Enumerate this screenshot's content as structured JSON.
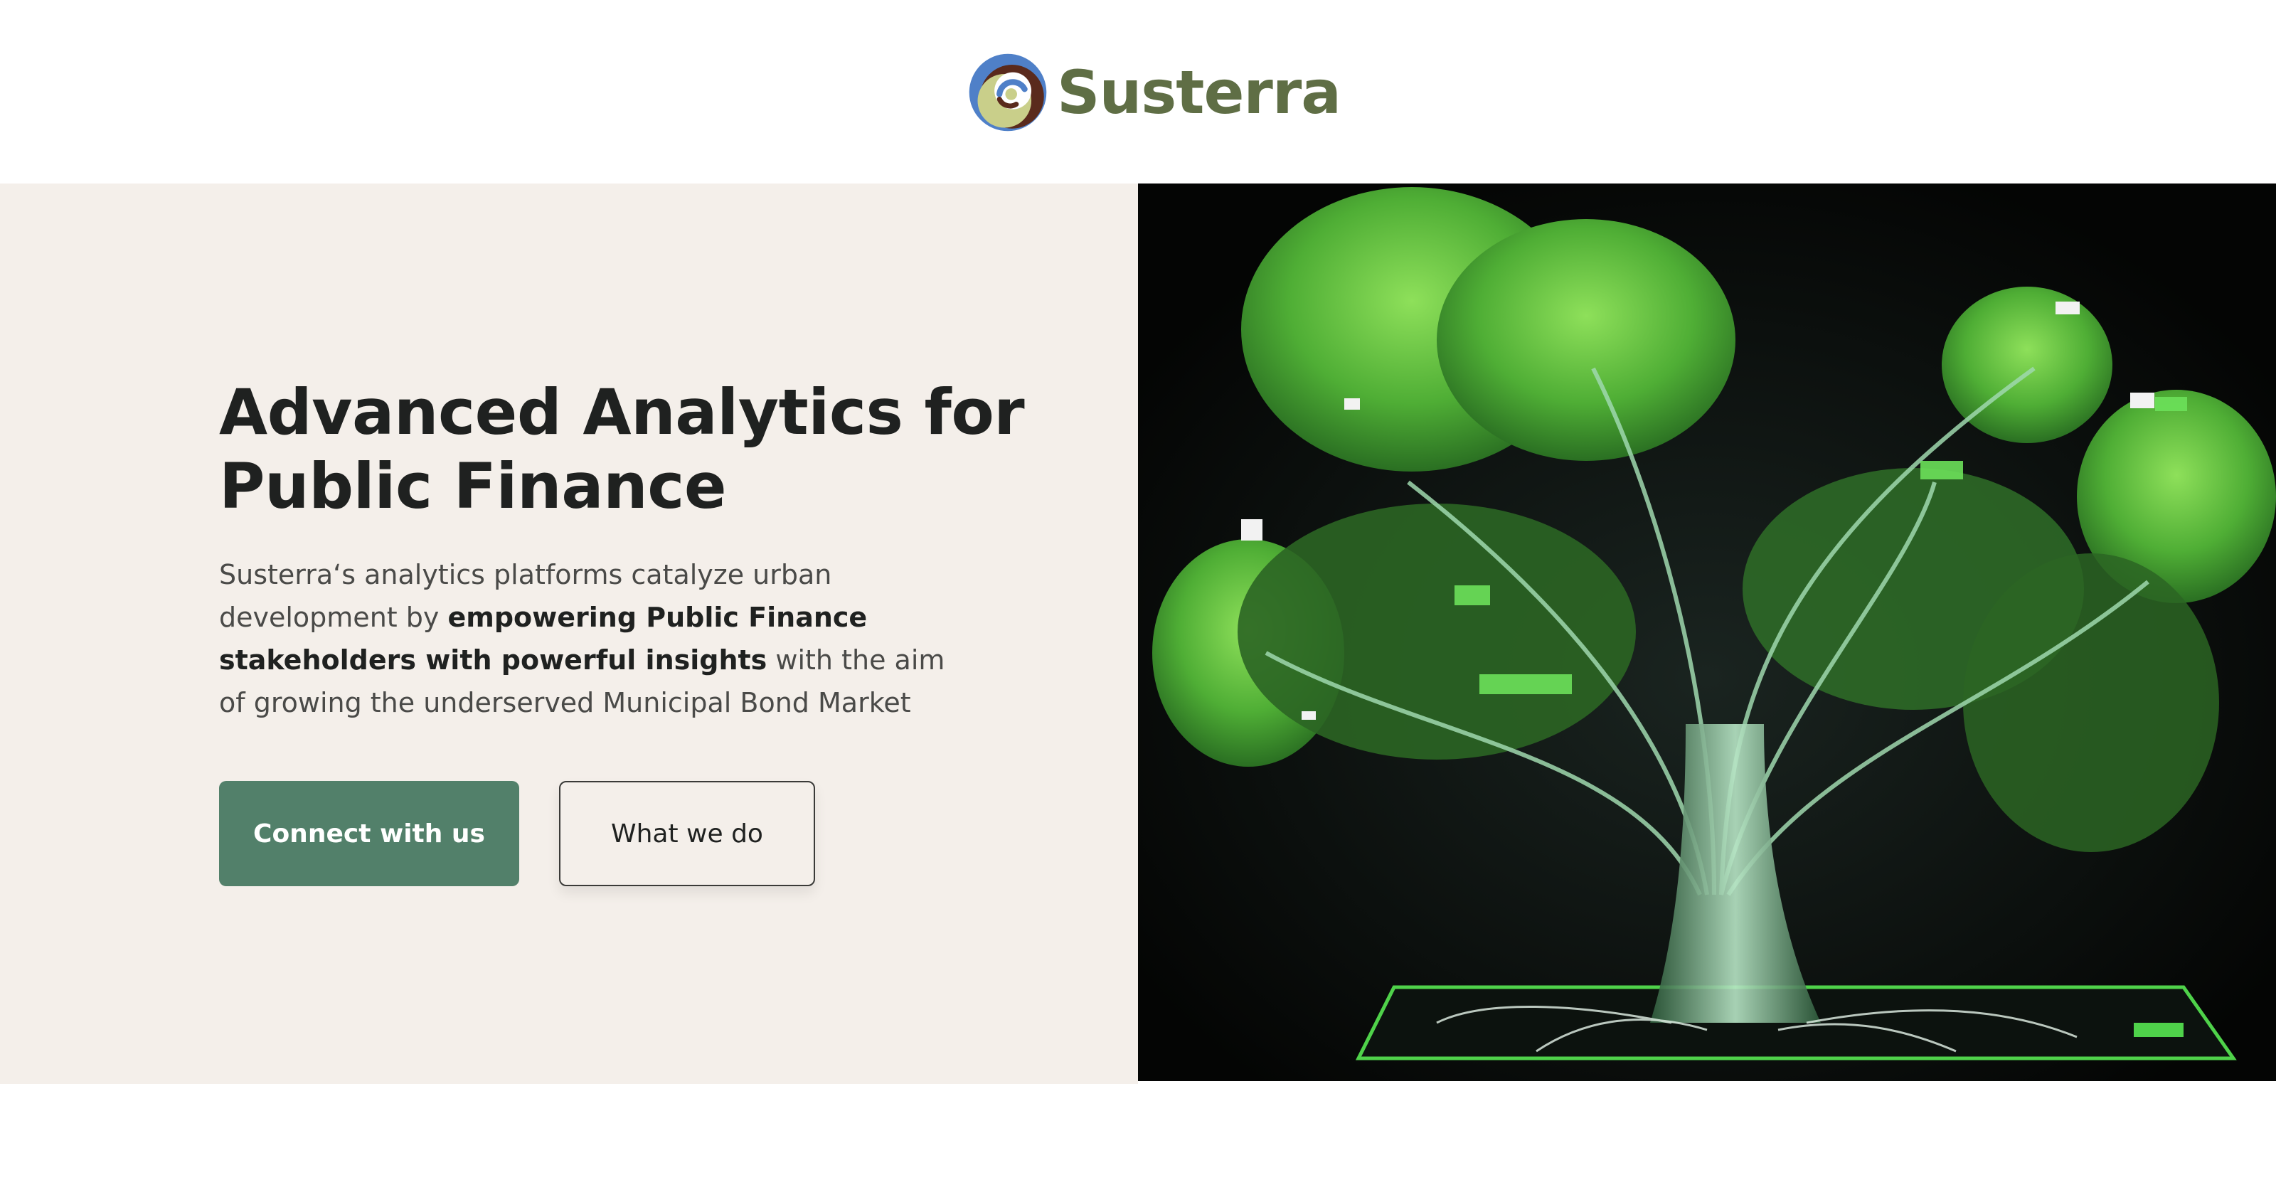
{
  "header": {
    "brand_name": "Susterra",
    "logo_icon": "swirl-logo-icon",
    "colors": {
      "logo_blue": "#4f80c8",
      "logo_brown": "#5a2a1c",
      "logo_olive": "#c9cf8a",
      "brand_text": "#5f6e45"
    }
  },
  "hero": {
    "title_line1": "Advanced Analytics for",
    "title_line2": "Public Finance",
    "description": {
      "part1": "Susterra‘s analytics platforms catalyze urban development by ",
      "bold1": "empowering Public Finance stakeholders with powerful insights",
      "part2": " with the aim of growing the underserved Municipal Bond Market"
    },
    "primary_button": "Connect with us",
    "secondary_button": "What we do",
    "image_icon": "circuit-tree-illustration",
    "colors": {
      "background": "#f4efea",
      "primary_button": "#52806a",
      "image_background": "#050605",
      "tree_green": "#5cbf3e"
    }
  }
}
